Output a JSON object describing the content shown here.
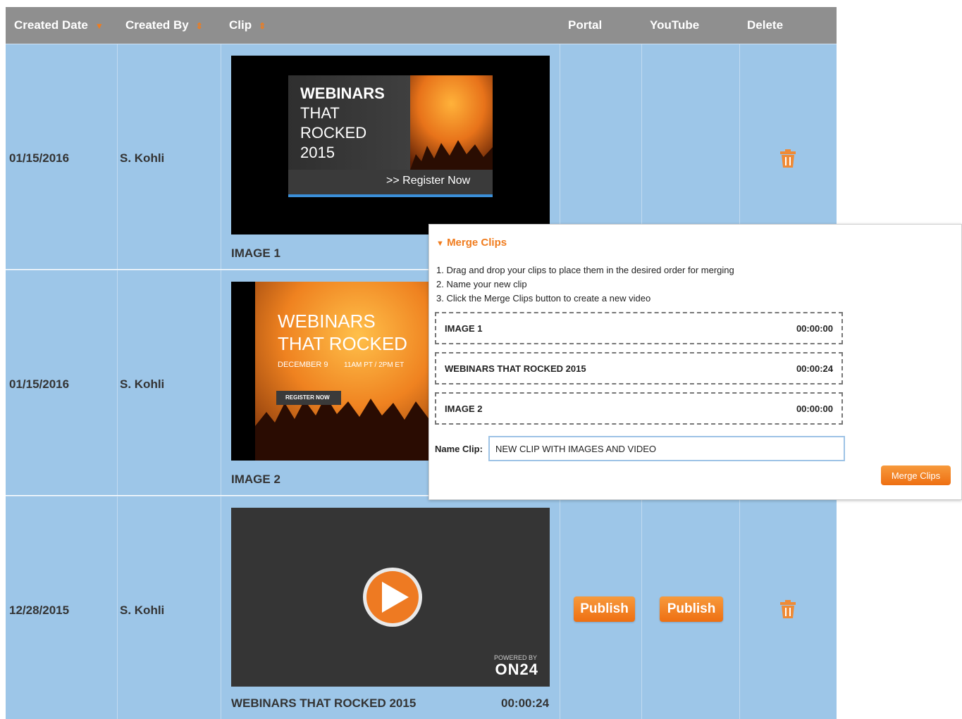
{
  "headers": {
    "created_date": "Created Date",
    "created_by": "Created By",
    "clip": "Clip",
    "portal": "Portal",
    "youtube": "YouTube",
    "delete": "Delete"
  },
  "rows": [
    {
      "date": "01/15/2016",
      "by": "S. Kohli",
      "clip_title": "IMAGE 1",
      "clip_duration": ""
    },
    {
      "date": "01/15/2016",
      "by": "S. Kohli",
      "clip_title": "IMAGE 2",
      "clip_duration": ""
    },
    {
      "date": "12/28/2015",
      "by": "S. Kohli",
      "clip_title": "WEBINARS THAT ROCKED 2015",
      "clip_duration": "00:00:24",
      "portal_button": "Publish",
      "youtube_button": "Publish"
    }
  ],
  "thumb1": {
    "line1": "WEBINARS",
    "line2": "THAT",
    "line3": "ROCKED",
    "line4": "2015",
    "register": ">> Register Now"
  },
  "thumb2": {
    "line1": "WEBINARS",
    "line2": "THAT ROCKED",
    "date": "DECEMBER 9",
    "time": "11AM PT / 2PM ET",
    "register": "REGISTER NOW"
  },
  "thumb3": {
    "powered": "POWERED BY",
    "brand": "ON24"
  },
  "merge_panel": {
    "title": "Merge Clips",
    "steps": [
      "1. Drag and drop your clips to place them in the desired order for merging",
      "2. Name your new clip",
      "3. Click the Merge Clips button to create a new video"
    ],
    "items": [
      {
        "name": "IMAGE 1",
        "duration": "00:00:00"
      },
      {
        "name": "WEBINARS THAT ROCKED 2015",
        "duration": "00:00:24"
      },
      {
        "name": "IMAGE 2",
        "duration": "00:00:00"
      }
    ],
    "name_label": "Name Clip:",
    "name_value": "NEW CLIP WITH IMAGES AND VIDEO",
    "button": "Merge Clips"
  },
  "colors": {
    "accent": "#f07c1e",
    "row_bg": "#9dc6e8",
    "header_bg": "#8f8f8f"
  }
}
